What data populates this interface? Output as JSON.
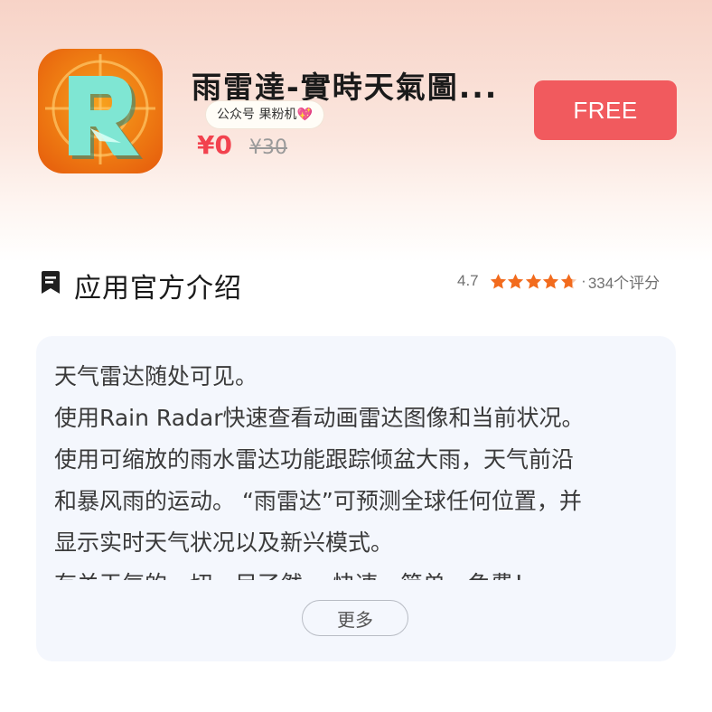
{
  "app": {
    "title": "雨雷達-實時天氣圖...",
    "icon": "radar-r-logo-icon",
    "price_now": "¥0",
    "price_original": "¥30",
    "get_button_label": "FREE"
  },
  "watermark": {
    "text": "公众号 果粉机",
    "icon": "heart-icon"
  },
  "section": {
    "icon": "bookmark-icon",
    "title": "应用官方介绍"
  },
  "rating": {
    "value": "4.7",
    "stars": 4.7,
    "star_max": 5,
    "separator": "·",
    "count_text": "334个评分",
    "star_color": "#f26b1d"
  },
  "description": {
    "text": "天气雷达随处可见。\n使用Rain Radar快速查看动画雷达图像和当前状况。\n使用可缩放的雨水雷达功能跟踪倾盆大雨，天气前沿\n和暴风雨的运动。 “雨雷达”可预测全球任何位置，并\n显示实时天气状况以及新兴模式。\n有关天气的一切一目了然。 快速，简单，免费！",
    "more_label": "更多"
  },
  "colors": {
    "accent": "#f15a5e",
    "price": "#f2424e",
    "card_bg": "#f4f7fd"
  }
}
